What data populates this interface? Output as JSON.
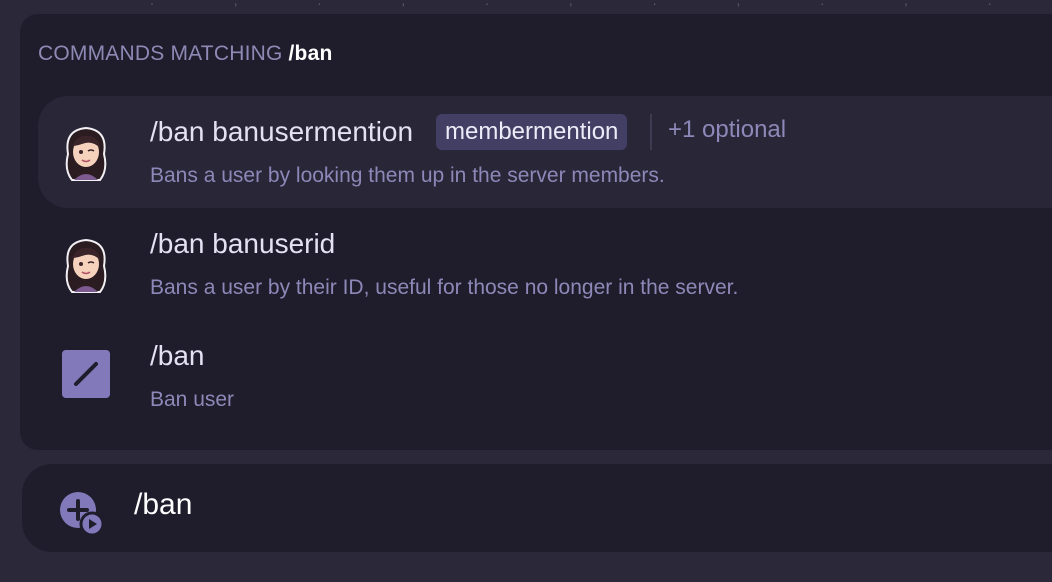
{
  "popup": {
    "header_label": "COMMANDS MATCHING",
    "header_query": "/ban"
  },
  "commands": [
    {
      "name": "/ban banusermention",
      "option": "membermention",
      "optional_count": "+1 optional",
      "description": "Bans a user by looking them up in the server members.",
      "icon": "bot-avatar",
      "selected": true
    },
    {
      "name": "/ban banuserid",
      "description": "Bans a user by their ID, useful for those no longer in the server.",
      "icon": "bot-avatar",
      "selected": false
    },
    {
      "name": "/ban",
      "description": "Ban user",
      "icon": "slash-command-icon",
      "selected": false
    }
  ],
  "input": {
    "value": "/ban",
    "icon": "add-attachment-icon"
  },
  "colors": {
    "background": "#2b2839",
    "panel": "#1f1d2b",
    "selected_row": "#282637",
    "accent": "#8179ba",
    "pill": "#433f64",
    "muted_text": "#8d88b8"
  }
}
